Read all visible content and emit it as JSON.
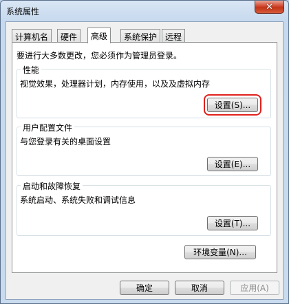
{
  "window": {
    "title": "系统属性",
    "close_label": "✕"
  },
  "tabs": [
    {
      "label": "计算机名"
    },
    {
      "label": "硬件"
    },
    {
      "label": "高级"
    },
    {
      "label": "系统保护"
    },
    {
      "label": "远程"
    }
  ],
  "active_tab": "高级",
  "panel": {
    "intro": "要进行大多数更改，您必须作为管理员登录。",
    "performance": {
      "title": "性能",
      "description": "视觉效果，处理器计划，内存使用，以及及虚拟内存",
      "button": "设置(S)..."
    },
    "user_profiles": {
      "title": "用户配置文件",
      "description": "与您登录有关的桌面设置",
      "button": "设置(E)..."
    },
    "startup_recovery": {
      "title": "启动和故障恢复",
      "description": "系统启动、系统失败和调试信息",
      "button": "设置(T)..."
    },
    "env_button": "环境变量(N)..."
  },
  "footer": {
    "ok": "确定",
    "cancel": "取消",
    "apply": "应用(A)"
  },
  "colors": {
    "highlight": "#e0201c",
    "close": "#c23616"
  }
}
